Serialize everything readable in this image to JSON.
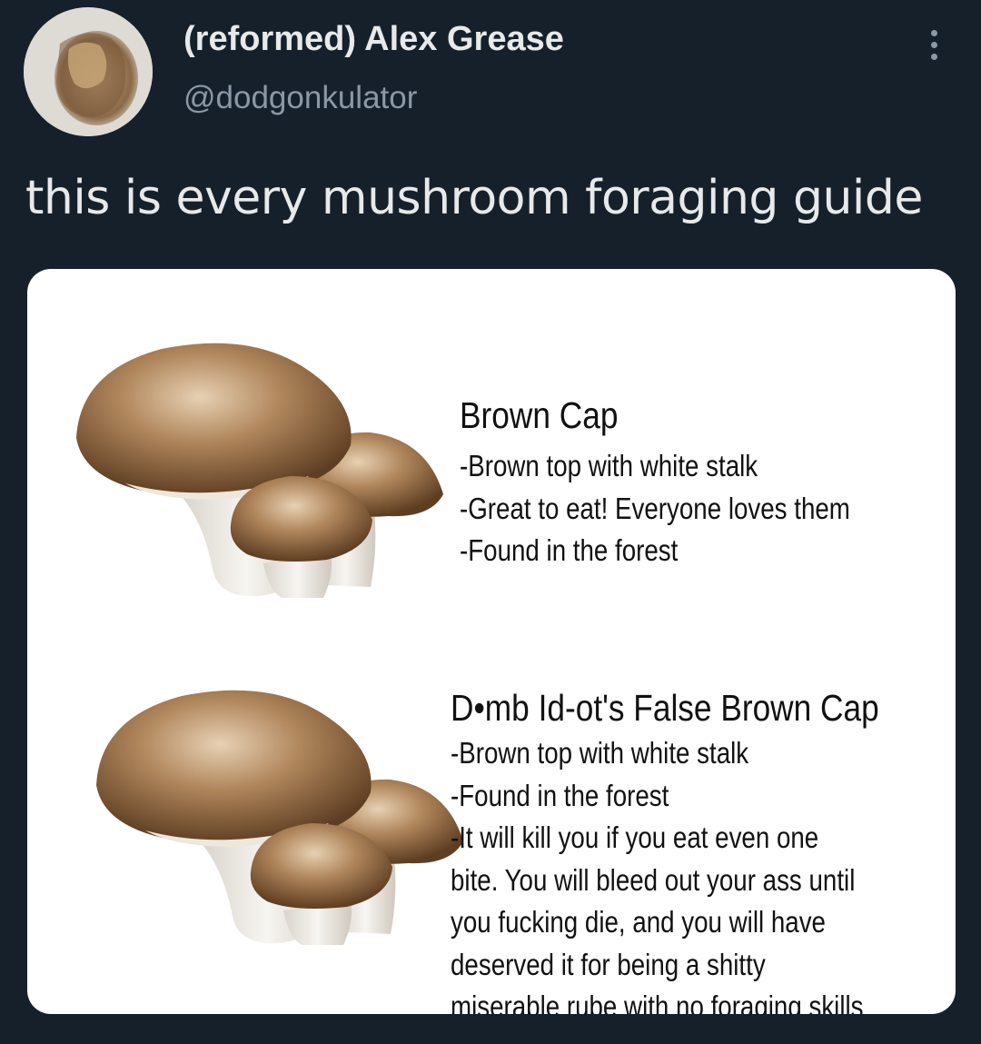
{
  "tweet": {
    "display_name": "(reformed) Alex Grease",
    "handle": "@dodgonkulator",
    "text": "this is every mushroom foraging guide",
    "more_icon": "more-vertical-icon"
  },
  "guide": {
    "entries": [
      {
        "title": "Brown Cap",
        "lines": [
          "-Brown top with white stalk",
          "-Great to eat! Everyone loves them",
          "-Found in the forest"
        ]
      },
      {
        "title": "D•mb Id-ot's False Brown Cap",
        "lines": [
          "-Brown top with white stalk",
          "-Found in the forest",
          "-It will kill you if you eat even one",
          "bite. You will bleed out your ass until",
          "you fucking die, and you will have",
          "deserved it for being a shitty",
          "miserable rube with no foraging skills"
        ]
      }
    ]
  }
}
